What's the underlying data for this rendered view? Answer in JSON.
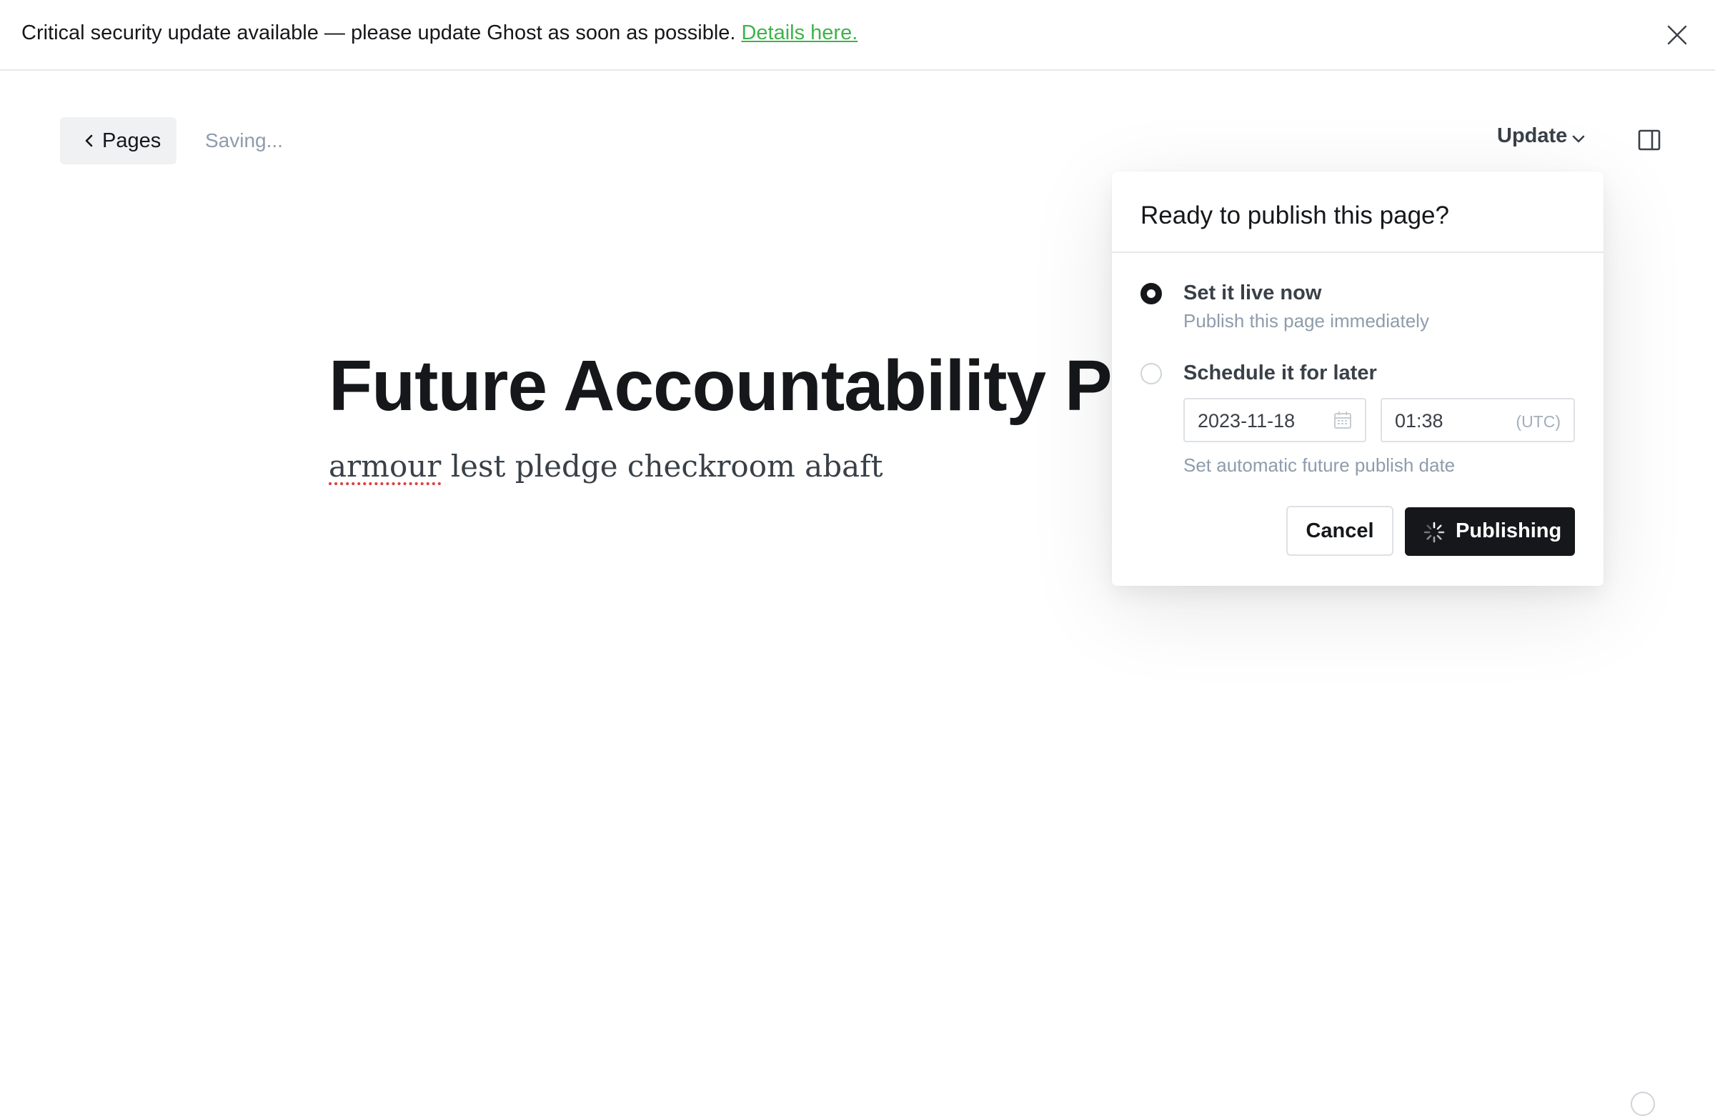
{
  "banner": {
    "message": "Critical security update available — please update Ghost as soon as possible.",
    "link_label": "Details here.",
    "close_icon": "close-icon"
  },
  "header": {
    "back_label": "Pages",
    "back_icon": "chevron-left-icon",
    "status": "Saving...",
    "update_label": "Update",
    "update_icon": "chevron-down-icon",
    "sidebar_icon": "sidebar-toggle-icon"
  },
  "editor": {
    "title": "Future Accountability Pla",
    "body_misspelled": "armour",
    "body_rest": " lest pledge checkroom abaft"
  },
  "publish_popover": {
    "title": "Ready to publish this page?",
    "options": [
      {
        "title": "Set it live now",
        "description": "Publish this page immediately",
        "selected": true
      },
      {
        "title": "Schedule it for later",
        "description": "Set automatic future publish date",
        "selected": false
      }
    ],
    "date_value": "2023-11-18",
    "time_value": "01:38",
    "timezone": "(UTC)",
    "cancel_label": "Cancel",
    "publish_label": "Publishing"
  },
  "colors": {
    "link": "#3eb34b",
    "primary_button": "#15171a",
    "muted_text": "#8e9cac"
  }
}
